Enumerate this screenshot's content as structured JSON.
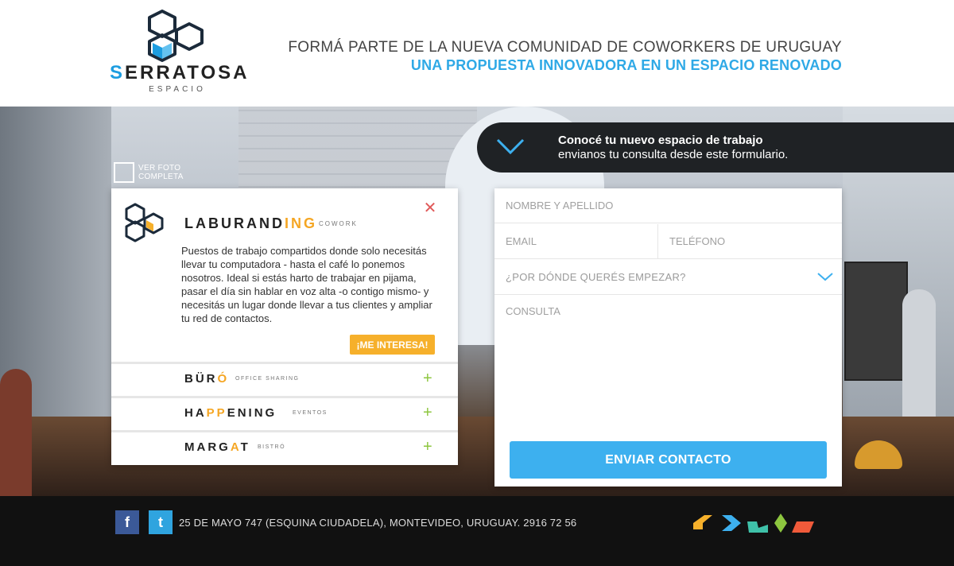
{
  "header": {
    "logo_prefix": "S",
    "logo_rest": "ERRATOSA",
    "logo_sub": "ESPACIO",
    "tagline_1": "FORMÁ PARTE DE LA NUEVA COMUNIDAD DE COWORKERS DE URUGUAY",
    "tagline_2": "UNA PROPUESTA INNOVADORA EN UN ESPACIO RENOVADO"
  },
  "view_photo": {
    "label": "VER FOTO COMPLETA",
    "icon": "external-photo-icon"
  },
  "banner": {
    "title": "Conocé tu nuevo espacio de trabajo",
    "subtitle": "envianos tu consulta desde este formulario.",
    "icon": "chevron-down-icon"
  },
  "card": {
    "brand_main": "LABURAND",
    "brand_accent": "ING",
    "brand_sub": "COWORK",
    "description": "Puestos de trabajo compartidos donde solo necesitás llevar tu computadora - hasta el café lo ponemos nosotros. Ideal si estás harto de trabajar en pijama, pasar el día sin hablar en voz alta -o contigo mismo- y necesitás un lugar donde llevar a tus clientes y ampliar tu red de contactos.",
    "interest_button": "¡ME INTERESA!",
    "close_icon": "close-icon",
    "rows": [
      {
        "name_before": "BÜR",
        "name_accent": "Ó",
        "name_after": "",
        "sub": "OFFICE SHARING",
        "plus": "+"
      },
      {
        "name_before": "HA",
        "name_accent": "PP",
        "name_after": "ENING",
        "sub": "EVENTOS",
        "plus": "+"
      },
      {
        "name_before": "MARG",
        "name_accent": "A",
        "name_after": "T",
        "sub": "BISTRÓ",
        "plus": "+"
      }
    ]
  },
  "form": {
    "name_placeholder": "NOMBRE Y APELLIDO",
    "email_placeholder": "EMAIL",
    "phone_placeholder": "TELÉFONO",
    "start_select": "¿POR DÓNDE QUERÉS EMPEZAR?",
    "query_placeholder": "CONSULTA",
    "submit": "ENVIAR CONTACTO"
  },
  "footer": {
    "facebook": "f",
    "twitter": "t",
    "address": "25 DE MAYO 747 (ESQUINA CIUDADELA), MONTEVIDEO, URUGUAY. 2916 72 56"
  },
  "colors": {
    "accent_blue": "#3db0ef",
    "accent_orange": "#f6b02b",
    "accent_green": "#8dc63f",
    "close_red": "#e05a5a"
  }
}
